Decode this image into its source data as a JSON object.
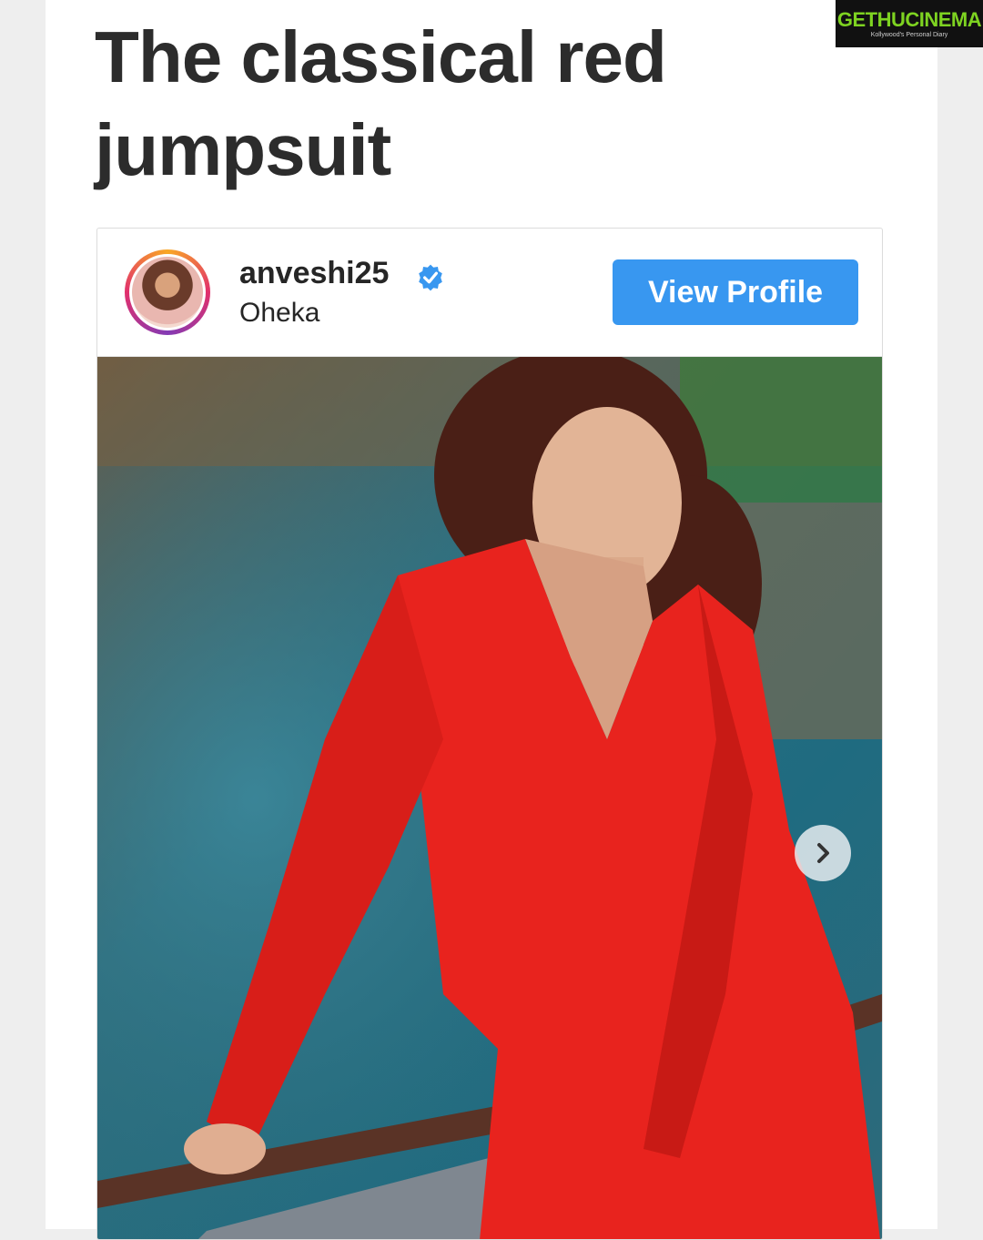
{
  "article": {
    "headline": "The classical red jumpsuit"
  },
  "embed": {
    "username": "anveshi25",
    "verified_icon": "verified-badge-icon",
    "location": "Oheka",
    "view_profile_label": "View Profile",
    "next_icon": "chevron-right-icon"
  },
  "watermark": {
    "brand": "GETHUCINEMA",
    "tagline": "Kollywood's Personal Diary"
  },
  "colors": {
    "button": "#3897f0",
    "verified": "#3897f0",
    "outfit": "#e8231e",
    "logo_accent": "#7ed321"
  }
}
